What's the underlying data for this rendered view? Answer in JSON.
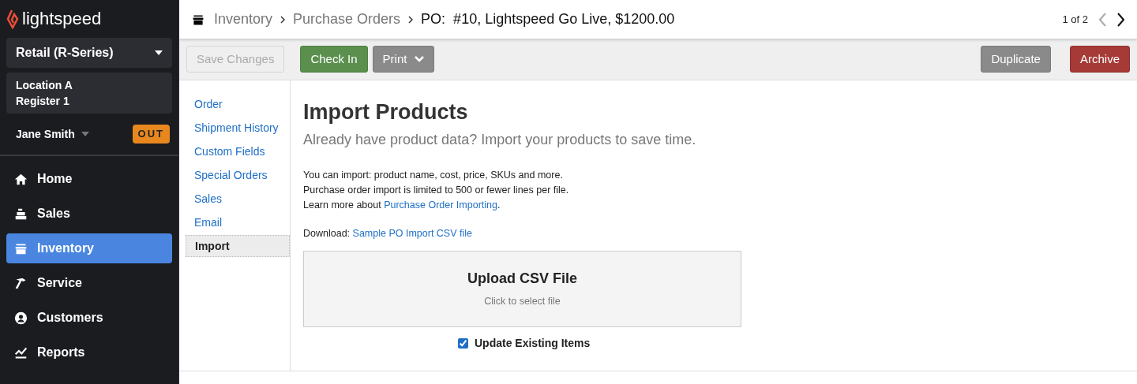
{
  "sidebar": {
    "logo": "lightspeed",
    "product": "Retail (R-Series)",
    "location": "Location A",
    "register": "Register 1",
    "user": "Jane Smith",
    "clock_badge": "OUT",
    "items": [
      {
        "label": "Home",
        "selected": false
      },
      {
        "label": "Sales",
        "selected": false
      },
      {
        "label": "Inventory",
        "selected": true
      },
      {
        "label": "Service",
        "selected": false
      },
      {
        "label": "Customers",
        "selected": false
      },
      {
        "label": "Reports",
        "selected": false
      }
    ]
  },
  "breadcrumb": [
    "Inventory",
    "Purchase Orders"
  ],
  "title": "PO:  #10, Lightspeed Go Live, $1200.00",
  "pager": {
    "text": "1 of 2",
    "prev_disabled": true,
    "next_disabled": false
  },
  "toolbar": {
    "left": [
      {
        "label": "Save Changes",
        "kind": "disabled"
      },
      {
        "label": "Check In",
        "kind": "success"
      },
      {
        "label": "Print",
        "kind": "menu"
      }
    ],
    "right": [
      {
        "label": "Duplicate",
        "kind": "neutral"
      },
      {
        "label": "Archive",
        "kind": "danger"
      }
    ]
  },
  "tabs": [
    {
      "label": "Order",
      "selected": false
    },
    {
      "label": "Shipment History",
      "selected": false
    },
    {
      "label": "Custom Fields",
      "selected": false
    },
    {
      "label": "Special Orders",
      "selected": false
    },
    {
      "label": "Sales",
      "selected": false
    },
    {
      "label": "Email",
      "selected": false
    },
    {
      "label": "Import",
      "selected": true
    }
  ],
  "heading": "Import Products",
  "subheading": "Already have product data? Import your products to save time.",
  "info_lines": [
    {
      "text": "You can import: product name, cost, price, SKUs and more."
    },
    {
      "text": "Purchase order import is limited to 500 or fewer lines per file."
    },
    {
      "text": "Learn more about ",
      "link": "Purchase Order Importing",
      "after": "."
    }
  ],
  "download": {
    "text": "Download: ",
    "link": "Sample PO Import CSV file"
  },
  "upload": {
    "title": "Upload CSV File",
    "hint": "Click to select file"
  },
  "update_existing": {
    "label": "Update Existing Items",
    "checked": true
  }
}
